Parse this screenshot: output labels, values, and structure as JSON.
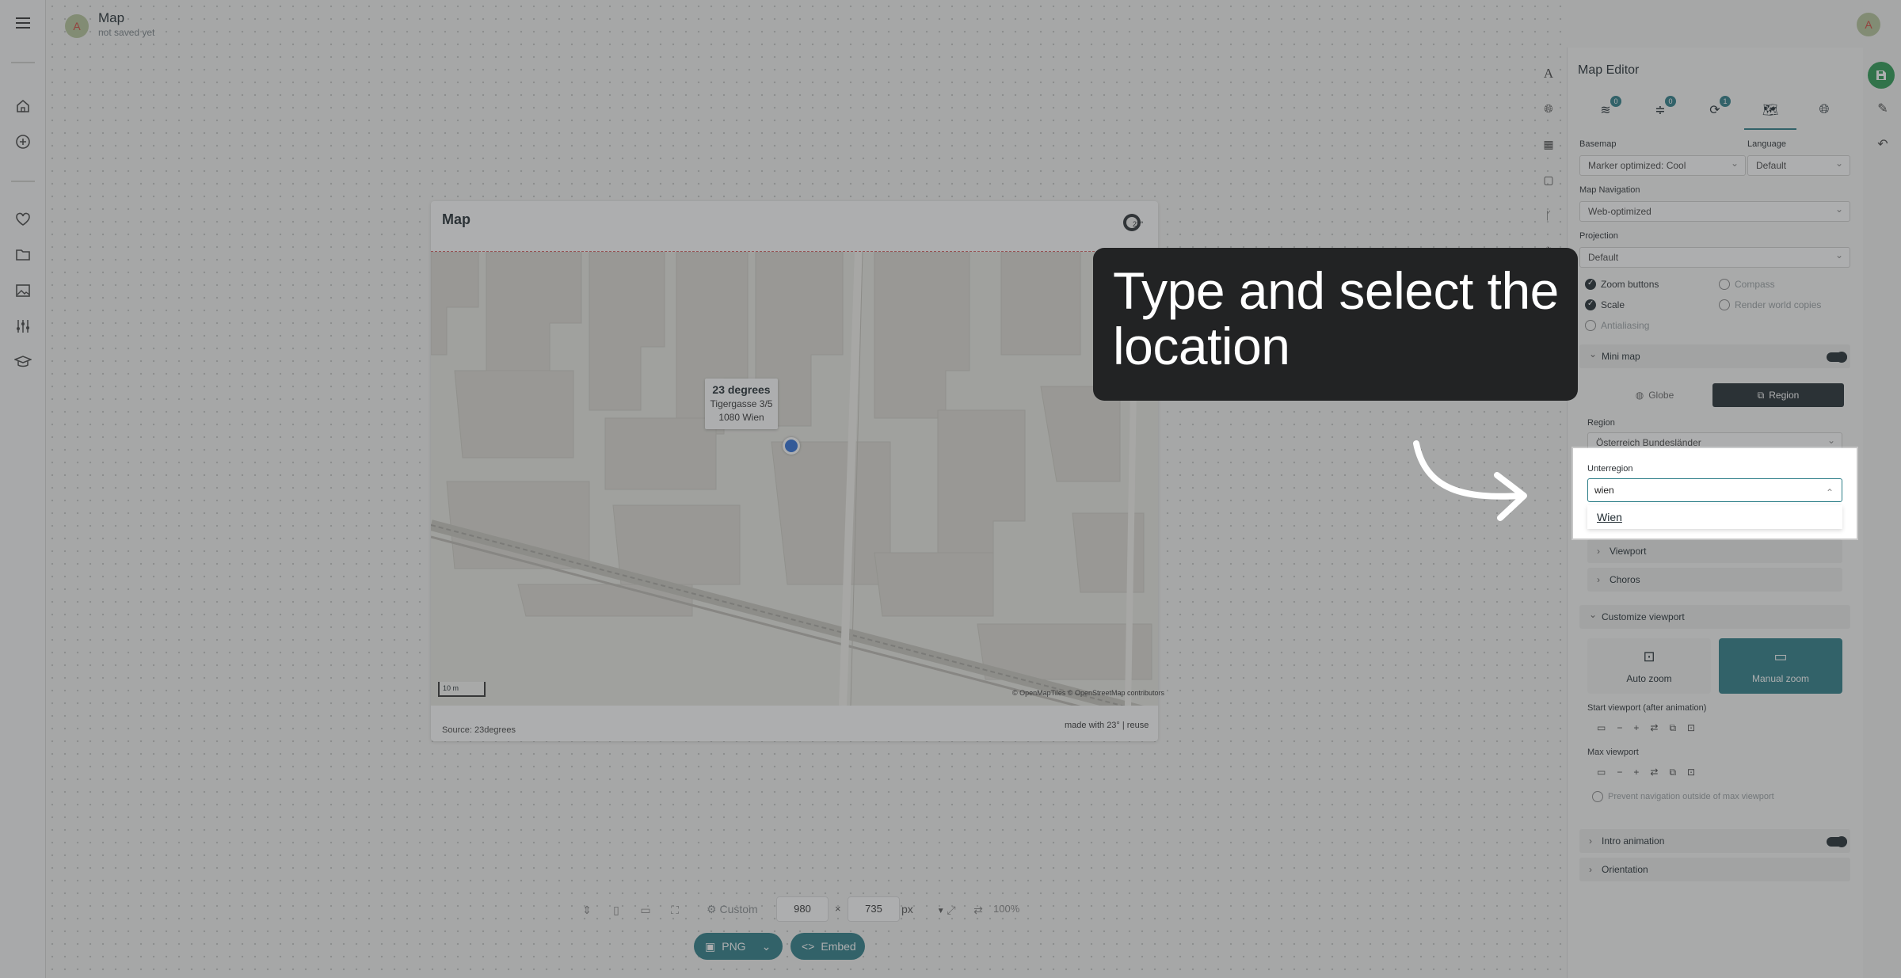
{
  "header": {
    "avatar_letter": "A",
    "title": "Map",
    "subtitle": "not saved yet"
  },
  "map": {
    "title": "Map",
    "popup": {
      "title": "23 degrees",
      "line1": "Tigergasse 3/5",
      "line2": "1080 Wien"
    },
    "scale_label": "10 m",
    "attribution": "© OpenMapTiles © OpenStreetMap contributors",
    "source": "Source: 23degrees",
    "made_with": "made with 23° | reuse"
  },
  "toolbar": {
    "preset": "Custom",
    "width": "980",
    "times": "×",
    "height": "735",
    "unit": "px",
    "zoom": "100%",
    "png_label": "PNG",
    "embed_label": "Embed"
  },
  "editor": {
    "title": "Map Editor",
    "tabs": [
      {
        "badge": "0"
      },
      {
        "badge": "0"
      },
      {
        "badge": "1"
      }
    ],
    "basemap": {
      "label": "Basemap",
      "value": "Marker optimized: Cool"
    },
    "language": {
      "label": "Language",
      "value": "Default"
    },
    "navigation": {
      "label": "Map Navigation",
      "value": "Web-optimized"
    },
    "projection": {
      "label": "Projection",
      "value": "Default"
    },
    "options": {
      "zoom_buttons": "Zoom buttons",
      "compass": "Compass",
      "scale": "Scale",
      "render_world_copies": "Render world copies",
      "antialiasing": "Antialiasing"
    },
    "mini_map": "Mini map",
    "mini_globe": "Globe",
    "mini_region": "Region",
    "region": {
      "label": "Region",
      "value": "Österreich Bundesländer"
    },
    "viewport": "Viewport",
    "choros": "Choros",
    "customize_viewport": "Customize viewport",
    "auto_zoom": "Auto zoom",
    "manual_zoom": "Manual zoom",
    "start_viewport": "Start viewport (after animation)",
    "max_viewport": "Max viewport",
    "prevent_navigation": "Prevent navigation outside of max viewport",
    "intro_animation": "Intro animation",
    "orientation": "Orientation"
  },
  "highlight": {
    "unterregion_label": "Unterregion",
    "unterregion_value": "wien",
    "option": "Wien"
  },
  "tooltip": {
    "text": "Type and select the location"
  },
  "colors": {
    "accent": "#2b7d87",
    "save": "#2a9a52",
    "marker": "#2d6fd8",
    "tooltip_bg": "#222324"
  }
}
